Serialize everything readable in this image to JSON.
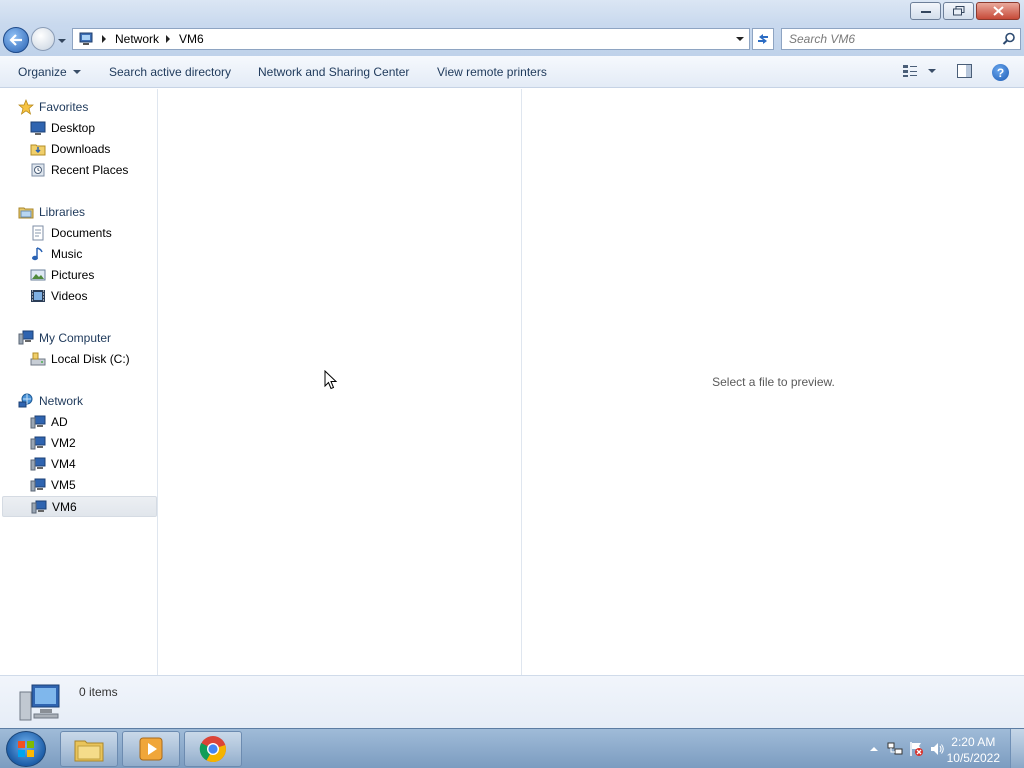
{
  "window": {
    "controls": [
      "minimize",
      "restore",
      "close"
    ]
  },
  "address": {
    "breadcrumbs": [
      "Network",
      "VM6"
    ],
    "search_placeholder": "Search VM6"
  },
  "commandbar": {
    "organize": "Organize",
    "search_ad": "Search active directory",
    "network_sharing": "Network and Sharing Center",
    "remote_printers": "View remote printers",
    "help": "?"
  },
  "sidebar": {
    "favorites": {
      "label": "Favorites",
      "items": [
        {
          "label": "Desktop",
          "icon": "desktop-icon"
        },
        {
          "label": "Downloads",
          "icon": "downloads-folder-icon"
        },
        {
          "label": "Recent Places",
          "icon": "recent-places-icon"
        }
      ]
    },
    "libraries": {
      "label": "Libraries",
      "items": [
        {
          "label": "Documents",
          "icon": "documents-icon"
        },
        {
          "label": "Music",
          "icon": "music-icon"
        },
        {
          "label": "Pictures",
          "icon": "pictures-icon"
        },
        {
          "label": "Videos",
          "icon": "videos-icon"
        }
      ]
    },
    "computer": {
      "label": "My Computer",
      "items": [
        {
          "label": "Local Disk (C:)",
          "icon": "local-disk-icon"
        }
      ]
    },
    "network": {
      "label": "Network",
      "items": [
        {
          "label": "AD",
          "icon": "computer-icon"
        },
        {
          "label": "VM2",
          "icon": "computer-icon"
        },
        {
          "label": "VM4",
          "icon": "computer-icon"
        },
        {
          "label": "VM5",
          "icon": "computer-icon"
        },
        {
          "label": "VM6",
          "icon": "computer-icon",
          "selected": true
        }
      ]
    }
  },
  "preview": {
    "message": "Select a file to preview."
  },
  "details": {
    "count": "0 items"
  },
  "taskbar": {
    "pinned": [
      "windows-explorer-icon",
      "media-player-icon",
      "chrome-icon"
    ],
    "clock_time": "2:20 AM",
    "clock_date": "10/5/2022"
  },
  "colors": {
    "accent": "#1e395b",
    "selection": "#e1e6ec",
    "taskbar": "#7c9cc0"
  }
}
